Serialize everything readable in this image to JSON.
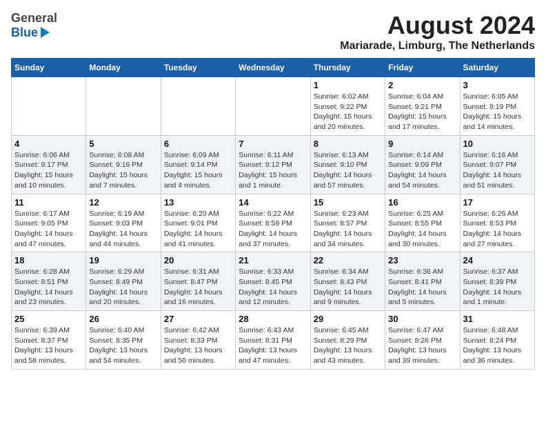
{
  "logo": {
    "line1": "General",
    "line2": "Blue"
  },
  "title": "August 2024",
  "subtitle": "Mariarade, Limburg, The Netherlands",
  "days_of_week": [
    "Sunday",
    "Monday",
    "Tuesday",
    "Wednesday",
    "Thursday",
    "Friday",
    "Saturday"
  ],
  "weeks": [
    [
      {
        "day": "",
        "info": ""
      },
      {
        "day": "",
        "info": ""
      },
      {
        "day": "",
        "info": ""
      },
      {
        "day": "",
        "info": ""
      },
      {
        "day": "1",
        "info": "Sunrise: 6:02 AM\nSunset: 9:22 PM\nDaylight: 15 hours\nand 20 minutes."
      },
      {
        "day": "2",
        "info": "Sunrise: 6:04 AM\nSunset: 9:21 PM\nDaylight: 15 hours\nand 17 minutes."
      },
      {
        "day": "3",
        "info": "Sunrise: 6:05 AM\nSunset: 9:19 PM\nDaylight: 15 hours\nand 14 minutes."
      }
    ],
    [
      {
        "day": "4",
        "info": "Sunrise: 6:06 AM\nSunset: 9:17 PM\nDaylight: 15 hours\nand 10 minutes."
      },
      {
        "day": "5",
        "info": "Sunrise: 6:08 AM\nSunset: 9:16 PM\nDaylight: 15 hours\nand 7 minutes."
      },
      {
        "day": "6",
        "info": "Sunrise: 6:09 AM\nSunset: 9:14 PM\nDaylight: 15 hours\nand 4 minutes."
      },
      {
        "day": "7",
        "info": "Sunrise: 6:11 AM\nSunset: 9:12 PM\nDaylight: 15 hours\nand 1 minute."
      },
      {
        "day": "8",
        "info": "Sunrise: 6:13 AM\nSunset: 9:10 PM\nDaylight: 14 hours\nand 57 minutes."
      },
      {
        "day": "9",
        "info": "Sunrise: 6:14 AM\nSunset: 9:09 PM\nDaylight: 14 hours\nand 54 minutes."
      },
      {
        "day": "10",
        "info": "Sunrise: 6:16 AM\nSunset: 9:07 PM\nDaylight: 14 hours\nand 51 minutes."
      }
    ],
    [
      {
        "day": "11",
        "info": "Sunrise: 6:17 AM\nSunset: 9:05 PM\nDaylight: 14 hours\nand 47 minutes."
      },
      {
        "day": "12",
        "info": "Sunrise: 6:19 AM\nSunset: 9:03 PM\nDaylight: 14 hours\nand 44 minutes."
      },
      {
        "day": "13",
        "info": "Sunrise: 6:20 AM\nSunset: 9:01 PM\nDaylight: 14 hours\nand 41 minutes."
      },
      {
        "day": "14",
        "info": "Sunrise: 6:22 AM\nSunset: 8:59 PM\nDaylight: 14 hours\nand 37 minutes."
      },
      {
        "day": "15",
        "info": "Sunrise: 6:23 AM\nSunset: 8:57 PM\nDaylight: 14 hours\nand 34 minutes."
      },
      {
        "day": "16",
        "info": "Sunrise: 6:25 AM\nSunset: 8:55 PM\nDaylight: 14 hours\nand 30 minutes."
      },
      {
        "day": "17",
        "info": "Sunrise: 6:26 AM\nSunset: 8:53 PM\nDaylight: 14 hours\nand 27 minutes."
      }
    ],
    [
      {
        "day": "18",
        "info": "Sunrise: 6:28 AM\nSunset: 8:51 PM\nDaylight: 14 hours\nand 23 minutes."
      },
      {
        "day": "19",
        "info": "Sunrise: 6:29 AM\nSunset: 8:49 PM\nDaylight: 14 hours\nand 20 minutes."
      },
      {
        "day": "20",
        "info": "Sunrise: 6:31 AM\nSunset: 8:47 PM\nDaylight: 14 hours\nand 16 minutes."
      },
      {
        "day": "21",
        "info": "Sunrise: 6:33 AM\nSunset: 8:45 PM\nDaylight: 14 hours\nand 12 minutes."
      },
      {
        "day": "22",
        "info": "Sunrise: 6:34 AM\nSunset: 8:43 PM\nDaylight: 14 hours\nand 9 minutes."
      },
      {
        "day": "23",
        "info": "Sunrise: 6:36 AM\nSunset: 8:41 PM\nDaylight: 14 hours\nand 5 minutes."
      },
      {
        "day": "24",
        "info": "Sunrise: 6:37 AM\nSunset: 8:39 PM\nDaylight: 14 hours\nand 1 minute."
      }
    ],
    [
      {
        "day": "25",
        "info": "Sunrise: 6:39 AM\nSunset: 8:37 PM\nDaylight: 13 hours\nand 58 minutes."
      },
      {
        "day": "26",
        "info": "Sunrise: 6:40 AM\nSunset: 8:35 PM\nDaylight: 13 hours\nand 54 minutes."
      },
      {
        "day": "27",
        "info": "Sunrise: 6:42 AM\nSunset: 8:33 PM\nDaylight: 13 hours\nand 50 minutes."
      },
      {
        "day": "28",
        "info": "Sunrise: 6:43 AM\nSunset: 8:31 PM\nDaylight: 13 hours\nand 47 minutes."
      },
      {
        "day": "29",
        "info": "Sunrise: 6:45 AM\nSunset: 8:29 PM\nDaylight: 13 hours\nand 43 minutes."
      },
      {
        "day": "30",
        "info": "Sunrise: 6:47 AM\nSunset: 8:26 PM\nDaylight: 13 hours\nand 39 minutes."
      },
      {
        "day": "31",
        "info": "Sunrise: 6:48 AM\nSunset: 8:24 PM\nDaylight: 13 hours\nand 36 minutes."
      }
    ]
  ]
}
